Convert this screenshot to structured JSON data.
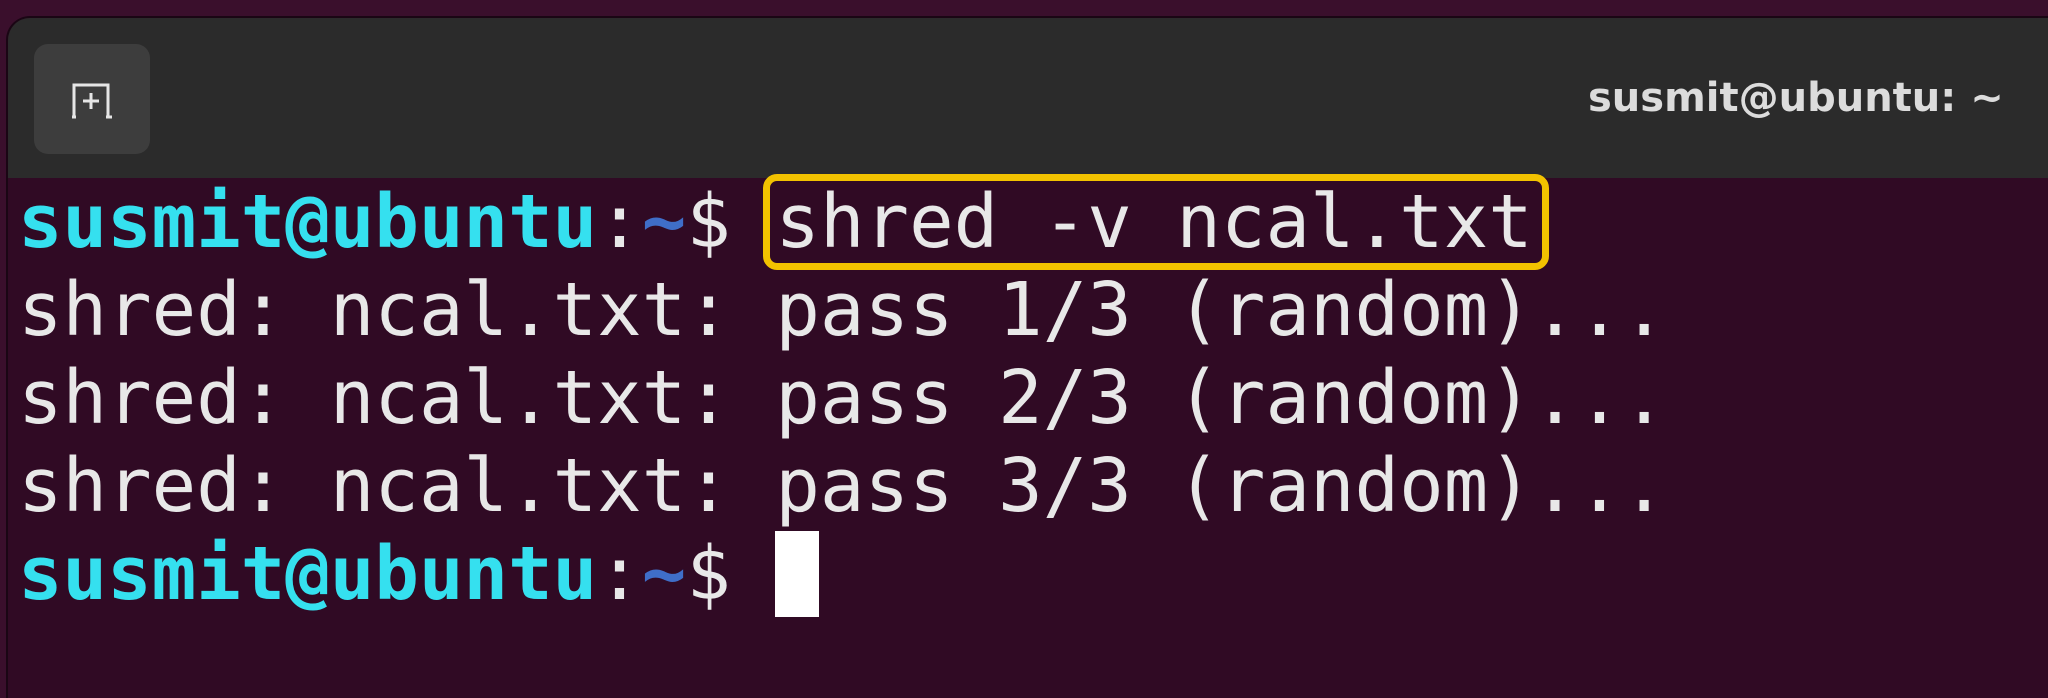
{
  "window": {
    "title": "susmit@ubuntu: ~"
  },
  "titlebar": {
    "new_tab_icon": "new-tab-icon"
  },
  "terminal": {
    "prompt_user": "susmit@ubuntu",
    "prompt_colon": ":",
    "prompt_path": "~",
    "prompt_dollar": "$ ",
    "command": "shred -v ncal.txt",
    "output": [
      "shred: ncal.txt: pass 1/3 (random)...",
      "shred: ncal.txt: pass 2/3 (random)...",
      "shred: ncal.txt: pass 3/3 (random)..."
    ]
  },
  "colors": {
    "background": "#300a24",
    "titlebar": "#2b2b2b",
    "prompt_user": "#35e0ef",
    "prompt_path": "#3f6ec8",
    "highlight": "#f2c200",
    "text": "#e8e8e8"
  }
}
